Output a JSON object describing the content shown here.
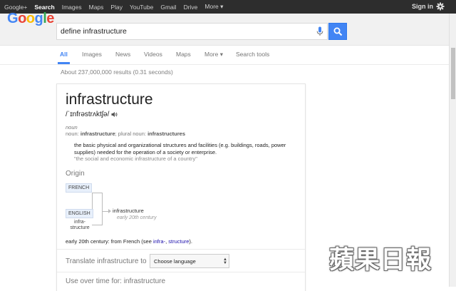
{
  "topbar": {
    "nav": [
      "Google+",
      "Search",
      "Images",
      "Maps",
      "Play",
      "YouTube",
      "Gmail",
      "Drive",
      "More ▾"
    ],
    "active_index": 1,
    "signin": "Sign in"
  },
  "header": {
    "logo": [
      "G",
      "o",
      "o",
      "g",
      "l",
      "e"
    ],
    "query": "define infrastructure"
  },
  "tabs": {
    "items": [
      "All",
      "Images",
      "News",
      "Videos",
      "Maps",
      "More ▾",
      "Search tools"
    ],
    "active_index": 0
  },
  "results_stats": "About 237,000,000 results (0.31 seconds)",
  "dictionary": {
    "word": "infrastructure",
    "phonetic": "/ˈɪnfrəstrʌktʃə/",
    "part_of_speech": "noun",
    "forms_prefix": "noun: ",
    "forms_word": "infrastructure",
    "forms_mid": "; plural noun: ",
    "forms_plural": "infrastructures",
    "definition": "the basic physical and organizational structures and facilities (e.g. buildings, roads, power supplies) needed for the operation of a society or enterprise.",
    "example": "\"the social and economic infrastructure of a country\"",
    "origin_heading": "Origin",
    "origin_lang_1": "FRENCH",
    "origin_lang_2": "ENGLISH",
    "origin_morph_1": "infra-",
    "origin_morph_2": "structure",
    "evolved_word": "infrastructure",
    "evolved_century": "early 20th century",
    "etymology_prefix": "early 20th century: from French (see ",
    "etymology_link_1": "infra-",
    "etymology_sep": ", ",
    "etymology_link_2": "structure",
    "etymology_suffix": ").",
    "translate_label": "Translate infrastructure to",
    "language_select": "Choose language",
    "use_over_time": "Use over time for: infrastructure"
  },
  "watermark": "蘋果日報",
  "colors": {
    "topbar_bg": "#2d2d2d",
    "accent_blue": "#4285f4",
    "link": "#1a0dab"
  }
}
